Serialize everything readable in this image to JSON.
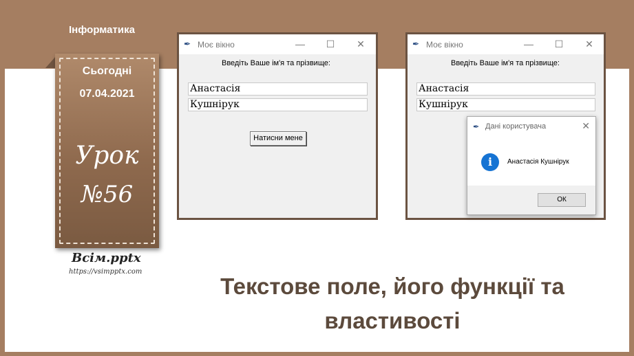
{
  "header": {
    "subject": "Інформатика"
  },
  "card": {
    "today_label": "Сьогодні",
    "date": "07.04.2021",
    "lesson_label": "Урок",
    "lesson_number": "№56"
  },
  "brand": {
    "name": "Всім.pptx",
    "url": "https://vsimpptx.com"
  },
  "slide_title": {
    "line1": "Текстове поле, його функції та",
    "line2": "властивості"
  },
  "window1": {
    "title": "Моє вікно",
    "prompt": "Введіть Ваше ім'я та прізвище:",
    "first_name": "Анастасія",
    "last_name": "Кушнірук",
    "button_label": "Натисни мене",
    "controls": {
      "minimize": "—",
      "maximize": "☐",
      "close": "✕"
    }
  },
  "window2": {
    "title": "Моє вікно",
    "prompt": "Введіть Ваше ім'я та прізвище:",
    "first_name": "Анастасія",
    "last_name": "Кушнірук",
    "controls": {
      "minimize": "—",
      "maximize": "☐",
      "close": "✕"
    },
    "dialog": {
      "title": "Дані користувача",
      "info_glyph": "i",
      "message": "Анастасія  Кушнірук",
      "ok_label": "ОК",
      "close": "✕"
    }
  },
  "colors": {
    "frame": "#a57e61",
    "title_text": "#5c4a3c",
    "info_icon": "#1573d3"
  },
  "icons": {
    "window_icon": "feather-icon",
    "dialog_icon": "info-icon"
  }
}
